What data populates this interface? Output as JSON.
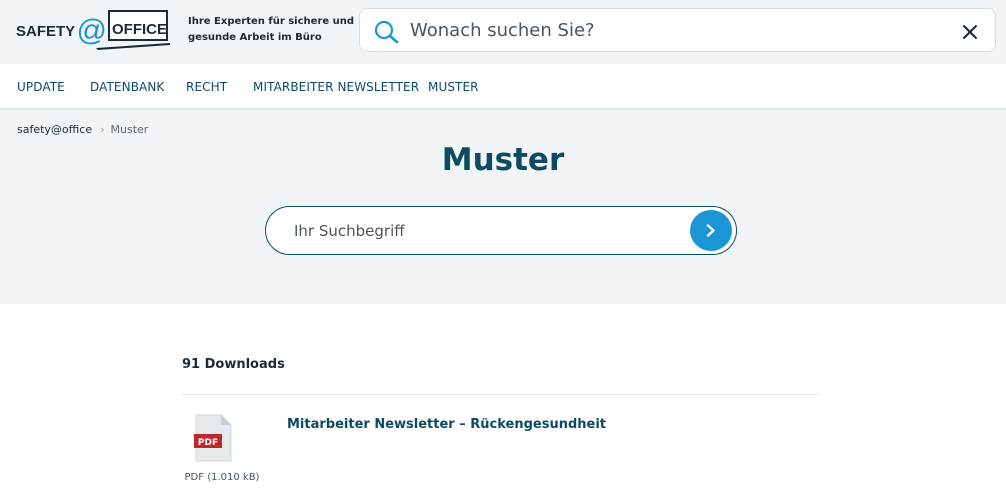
{
  "header": {
    "logo": {
      "left": "SAFETY",
      "at": "@",
      "right": "OFFICE"
    },
    "tagline": [
      "Ihre Experten für sichere und",
      "gesunde Arbeit im Büro"
    ],
    "search": {
      "placeholder": "Wonach suchen Sie?",
      "value": ""
    }
  },
  "nav": {
    "items": [
      {
        "label": "UPDATE"
      },
      {
        "label": "DATENBANK"
      },
      {
        "label": "RECHT"
      },
      {
        "label": "MITARBEITER NEWSLETTER"
      },
      {
        "label": "MUSTER"
      }
    ]
  },
  "breadcrumb": {
    "root": "safety@office",
    "current": "Muster"
  },
  "hero": {
    "title": "Muster",
    "search": {
      "placeholder": "Ihr Suchbegriff",
      "value": ""
    }
  },
  "results": {
    "count_label": "91 Downloads",
    "items": [
      {
        "title": "Mitarbeiter Newsletter – Rückengesundheit",
        "badge": "PDF",
        "meta": "PDF (1.010 kB)"
      }
    ]
  },
  "colors": {
    "brand_dark": "#0d4a63",
    "accent_blue": "#1a96d6",
    "pdf_red": "#c0272d",
    "hero_bg": "#f2f5f7"
  },
  "icons": {
    "top_search": "search-icon",
    "top_clear": "close-icon",
    "main_go": "chevron-right-icon",
    "file": "pdf-file-icon"
  }
}
